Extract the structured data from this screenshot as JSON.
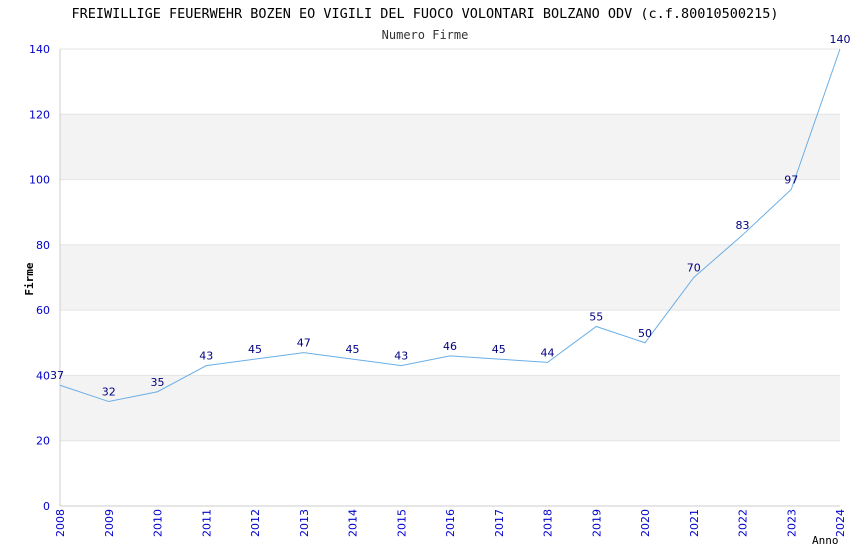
{
  "chart_data": {
    "type": "line",
    "title": "FREIWILLIGE FEUERWEHR BOZEN EO VIGILI DEL FUOCO VOLONTARI BOLZANO ODV (c.f.80010500215)",
    "subtitle": "Numero Firme",
    "xlabel": "Anno",
    "ylabel": "Firme",
    "x": [
      "2008",
      "2009",
      "2010",
      "2011",
      "2012",
      "2013",
      "2014",
      "2015",
      "2016",
      "2017",
      "2018",
      "2019",
      "2020",
      "2021",
      "2022",
      "2023",
      "2024"
    ],
    "values": [
      37,
      32,
      35,
      43,
      45,
      47,
      45,
      43,
      46,
      45,
      44,
      55,
      50,
      70,
      83,
      97,
      140
    ],
    "ylim": [
      0,
      140
    ],
    "yticks": [
      0,
      20,
      40,
      60,
      80,
      100,
      120,
      140
    ],
    "grid": true,
    "colors": {
      "line": "#6aaee6",
      "tick_label": "#0000cc",
      "data_label": "#000080",
      "band": "#f3f3f3",
      "axis": "#cccccc",
      "text": "#000000"
    }
  }
}
